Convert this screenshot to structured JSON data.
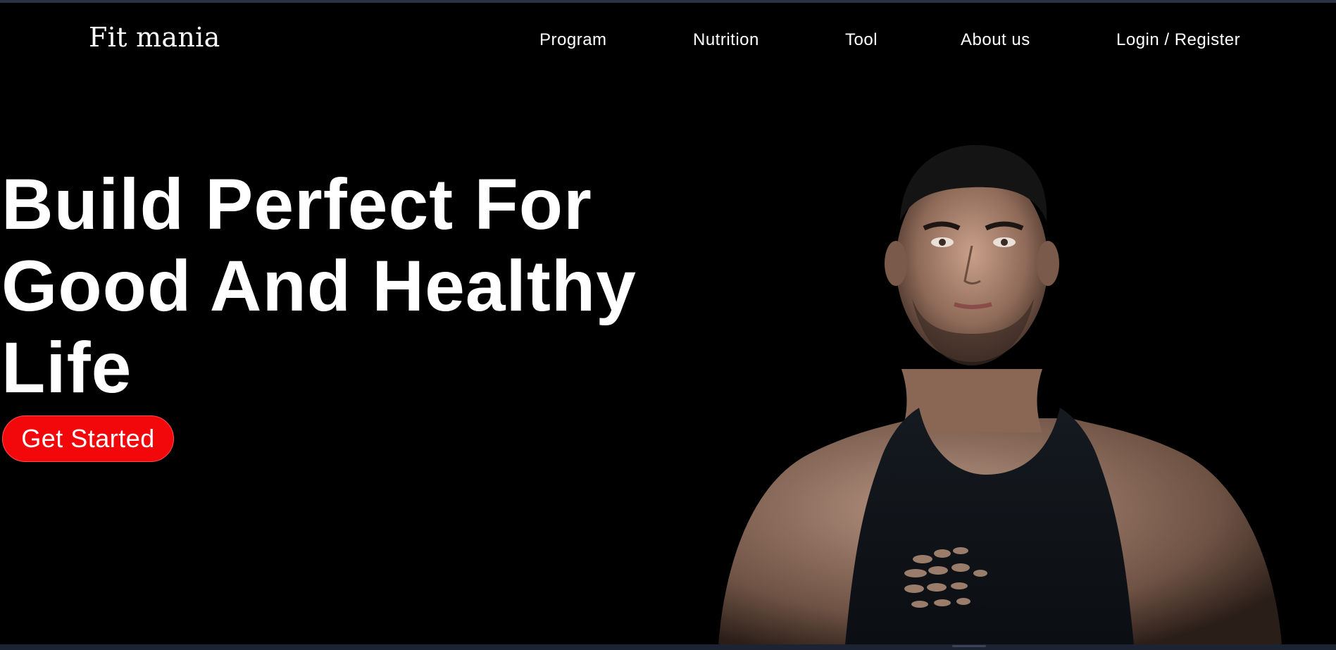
{
  "brand": {
    "logo": "Fit mania"
  },
  "nav": {
    "items": [
      {
        "label": "Program"
      },
      {
        "label": "Nutrition"
      },
      {
        "label": "Tool"
      },
      {
        "label": "About us"
      },
      {
        "label": "Login / Register"
      }
    ]
  },
  "hero": {
    "lines": [
      "Build Perfect For",
      "Good And Healthy",
      "Life"
    ],
    "cta_label": "Get Started"
  },
  "colors": {
    "background": "#000000",
    "text": "#ffffff",
    "accent": "#f2080b"
  },
  "image": {
    "subject": "muscular-man-in-black-tank-top"
  }
}
